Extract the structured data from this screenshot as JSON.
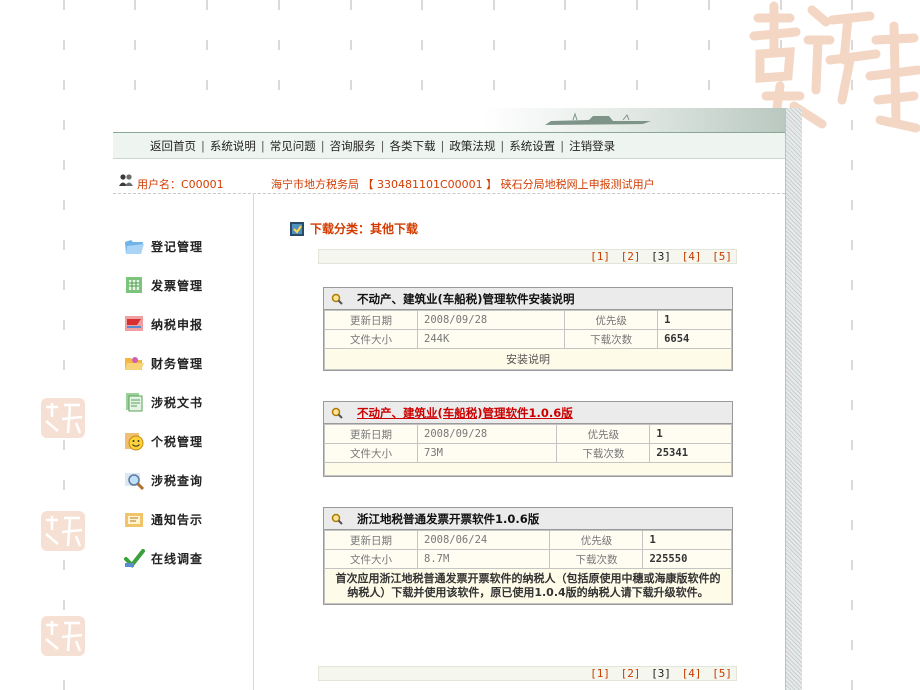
{
  "nav": {
    "items": [
      "返回首页",
      "系统说明",
      "常见问题",
      "咨询服务",
      "各类下载",
      "政策法规",
      "系统设置",
      "注销登录"
    ],
    "separator": "|"
  },
  "user": {
    "label": "用户名：C00001",
    "org_info": "海宁市地方税务局 【 330481101C00001 】 硖石分局地税网上申报测试用户"
  },
  "sidebar": {
    "items": [
      {
        "label": "登记管理",
        "icon": "folder-icon"
      },
      {
        "label": "发票管理",
        "icon": "invoice-icon"
      },
      {
        "label": "纳税申报",
        "icon": "flag-icon"
      },
      {
        "label": "财务管理",
        "icon": "folder-open-icon"
      },
      {
        "label": "涉税文书",
        "icon": "document-icon"
      },
      {
        "label": "个税管理",
        "icon": "smiley-icon"
      },
      {
        "label": "涉税查询",
        "icon": "magnifier-icon"
      },
      {
        "label": "通知告示",
        "icon": "notice-icon"
      },
      {
        "label": "在线调查",
        "icon": "checkmark-icon"
      }
    ]
  },
  "category": {
    "title": "下载分类：其他下载"
  },
  "pager": {
    "pages": [
      "[1]",
      "[2]",
      "[3]",
      "[4]",
      "[5]"
    ],
    "current_index": 2
  },
  "cards": [
    {
      "title": "不动产、建筑业(车船税)管理软件安装说明",
      "title_link": false,
      "labels": {
        "updated": "更新日期",
        "priority": "优先级",
        "size": "文件大小",
        "downloads": "下载次数"
      },
      "updated": "2008/09/28",
      "priority": "1",
      "size": "244K",
      "downloads": "6654",
      "footer": "安装说明"
    },
    {
      "title": "不动产、建筑业(车船税)管理软件1.0.6版",
      "title_link": true,
      "labels": {
        "updated": "更新日期",
        "priority": "优先级",
        "size": "文件大小",
        "downloads": "下载次数"
      },
      "updated": "2008/09/28",
      "priority": "1",
      "size": "73M",
      "downloads": "25341",
      "footer": ""
    },
    {
      "title": "浙江地税普通发票开票软件1.0.6版",
      "title_link": false,
      "labels": {
        "updated": "更新日期",
        "priority": "优先级",
        "size": "文件大小",
        "downloads": "下载次数"
      },
      "updated": "2008/06/24",
      "priority": "1",
      "size": "8.7M",
      "downloads": "225550",
      "description": "首次应用浙江地税普通发票开票软件的纳税人（包括原使用中穗或海康版软件的纳税人）下载并使用该软件，原已使用1.0.4版的纳税人请下载升级软件。"
    }
  ],
  "colors": {
    "accent": "#d23c00",
    "link_red": "#cc0000",
    "nav_bg": "#eef4ef",
    "card_header": "#ebebeb",
    "cell_bg": "#fffdf2"
  }
}
